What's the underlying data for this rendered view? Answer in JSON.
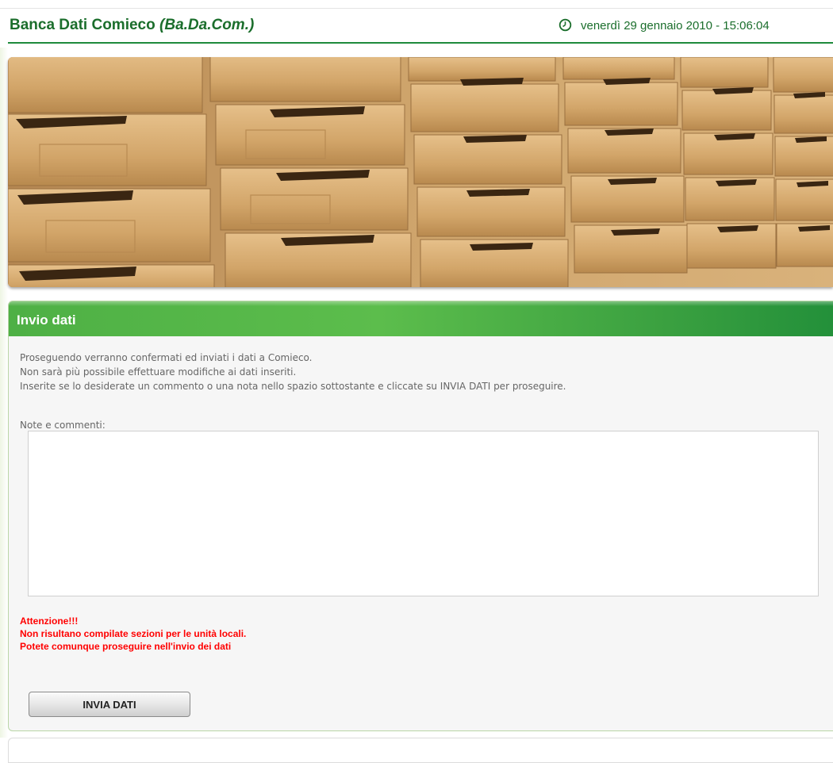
{
  "header": {
    "app_title": "Banca Dati Comieco",
    "app_abbr": "(Ba.Da.Com.)",
    "datetime": "venerdì 29 gennaio 2010 - 15:06:04",
    "clock_icon": "clock-icon",
    "accent_color": "#1b6e2c"
  },
  "banner": {
    "icon": "cardboard-boxes-image"
  },
  "panel": {
    "title": "Invio dati",
    "header_color": "#4eb045",
    "info_lines": [
      "Proseguendo verranno confermati ed inviati i dati a Comieco.",
      "Non sarà più possibile effettuare modifiche ai dati inseriti.",
      "Inserite se lo desiderate un commento o una nota nello spazio sottostante e cliccate su INVIA DATI per proseguire."
    ],
    "notes_label": "Note e commenti:",
    "notes_value": "",
    "warning_lines": [
      "Attenzione!!!",
      "Non risultano compilate sezioni per le unità locali.",
      "Potete comunque proseguire nell'invio dei dati"
    ],
    "warning_color": "#ff0000",
    "submit_label": "INVIA DATI"
  }
}
